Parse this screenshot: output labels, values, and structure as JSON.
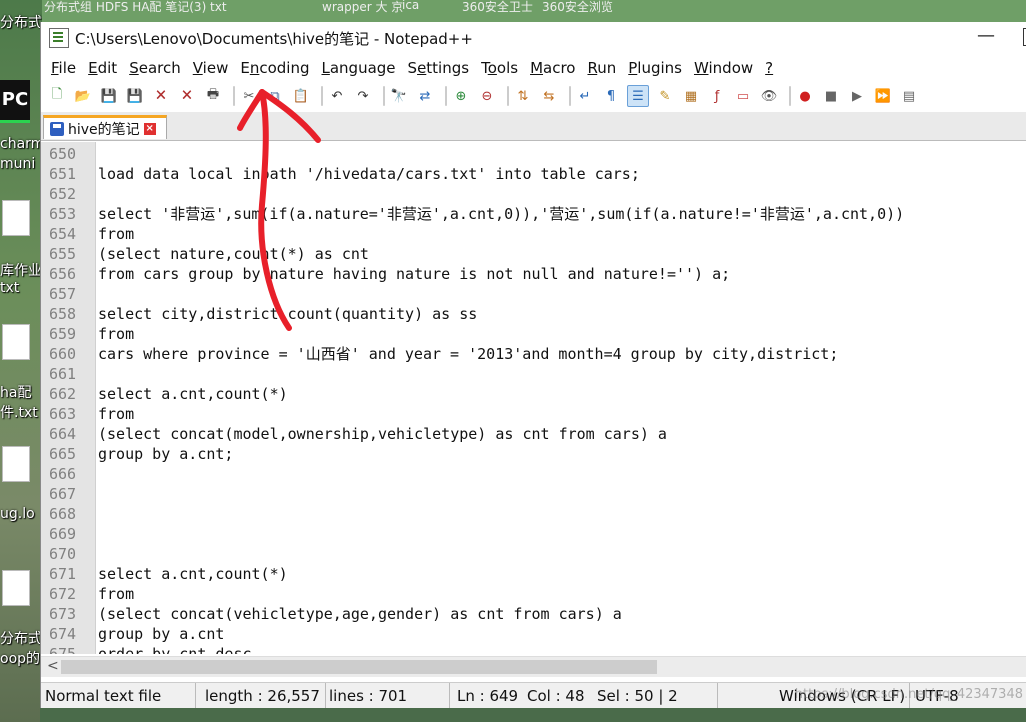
{
  "desktop": {
    "top_strip_texts": [
      "分布式组 HDFS HA配 笔记(3) txt",
      "wrapper 大 京",
      "ica",
      "360安全卫士",
      "360安全浏览"
    ],
    "icons": [
      {
        "label": "PC",
        "sub": ""
      },
      {
        "label": "charm",
        "sub": "muni"
      },
      {
        "label": "库作业",
        "sub": "txt"
      },
      {
        "label": "ha配",
        "sub": "件.txt"
      },
      {
        "label": "ug.lo",
        "sub": ""
      },
      {
        "label": "分布式",
        "sub": "oop的"
      }
    ]
  },
  "window": {
    "title": "C:\\Users\\Lenovo\\Documents\\hive的笔记 - Notepad++",
    "minimize_glyph": "—",
    "menu": [
      {
        "label": "File",
        "ul": "F",
        "rest": "ile"
      },
      {
        "label": "Edit",
        "ul": "E",
        "rest": "dit"
      },
      {
        "label": "Search",
        "ul": "S",
        "rest": "earch"
      },
      {
        "label": "View",
        "ul": "V",
        "rest": "iew"
      },
      {
        "label": "Encoding",
        "ul": "n",
        "pre": "E",
        "rest": "coding"
      },
      {
        "label": "Language",
        "ul": "L",
        "rest": "anguage"
      },
      {
        "label": "Settings",
        "ul": "e",
        "pre": "S",
        "rest": "ttings"
      },
      {
        "label": "Tools",
        "ul": "o",
        "pre": "T",
        "rest": "ols"
      },
      {
        "label": "Macro",
        "ul": "M",
        "rest": "acro"
      },
      {
        "label": "Run",
        "ul": "R",
        "rest": "un"
      },
      {
        "label": "Plugins",
        "ul": "P",
        "rest": "lugins"
      },
      {
        "label": "Window",
        "ul": "W",
        "rest": "indow"
      },
      {
        "label": "?",
        "ul": "?",
        "rest": ""
      }
    ],
    "toolbar": [
      {
        "name": "new-file-icon",
        "glyph": "🗋",
        "color": "#3a8a3a"
      },
      {
        "name": "open-file-icon",
        "glyph": "📂",
        "color": "#d8a22a"
      },
      {
        "name": "save-icon",
        "glyph": "💾",
        "color": "#3a5fa8"
      },
      {
        "name": "save-all-icon",
        "glyph": "💾",
        "color": "#3a5fa8"
      },
      {
        "name": "close-icon",
        "glyph": "🗙",
        "color": "#b03030"
      },
      {
        "name": "close-all-icon",
        "glyph": "🗙",
        "color": "#b03030"
      },
      {
        "name": "print-icon",
        "glyph": "🖶",
        "color": "#444"
      },
      {
        "name": "sep",
        "glyph": ""
      },
      {
        "name": "cut-icon",
        "glyph": "✂",
        "color": "#555"
      },
      {
        "name": "copy-icon",
        "glyph": "⧉",
        "color": "#4a6a9a"
      },
      {
        "name": "paste-icon",
        "glyph": "📋",
        "color": "#a07030"
      },
      {
        "name": "sep",
        "glyph": ""
      },
      {
        "name": "undo-icon",
        "glyph": "↶",
        "color": "#333"
      },
      {
        "name": "redo-icon",
        "glyph": "↷",
        "color": "#333"
      },
      {
        "name": "sep",
        "glyph": ""
      },
      {
        "name": "find-icon",
        "glyph": "🔭",
        "color": "#333"
      },
      {
        "name": "replace-icon",
        "glyph": "⇄",
        "color": "#2a6ab8"
      },
      {
        "name": "sep",
        "glyph": ""
      },
      {
        "name": "zoom-in-icon",
        "glyph": "⊕",
        "color": "#2a8a3a"
      },
      {
        "name": "zoom-out-icon",
        "glyph": "⊖",
        "color": "#b03030"
      },
      {
        "name": "sep",
        "glyph": ""
      },
      {
        "name": "sync-vertical-icon",
        "glyph": "⇅",
        "color": "#c07020"
      },
      {
        "name": "sync-horizontal-icon",
        "glyph": "⇆",
        "color": "#c07020"
      },
      {
        "name": "sep",
        "glyph": ""
      },
      {
        "name": "word-wrap-icon",
        "glyph": "↵",
        "color": "#2a6ab8"
      },
      {
        "name": "show-all-chars-icon",
        "glyph": "¶",
        "color": "#2a6ab8"
      },
      {
        "name": "indent-guide-icon",
        "glyph": "☰",
        "color": "#2a6ab8",
        "active": true
      },
      {
        "name": "udl-icon",
        "glyph": "✎",
        "color": "#c09020"
      },
      {
        "name": "doc-map-icon",
        "glyph": "▦",
        "color": "#b07020"
      },
      {
        "name": "function-list-icon",
        "glyph": "ƒ",
        "color": "#b03030"
      },
      {
        "name": "folder-workspace-icon",
        "glyph": "▭",
        "color": "#d05050"
      },
      {
        "name": "monitor-icon",
        "glyph": "👁",
        "color": "#555"
      },
      {
        "name": "sep",
        "glyph": ""
      },
      {
        "name": "record-macro-icon",
        "glyph": "●",
        "color": "#d02020"
      },
      {
        "name": "stop-record-icon",
        "glyph": "■",
        "color": "#666"
      },
      {
        "name": "play-macro-icon",
        "glyph": "▶",
        "color": "#666"
      },
      {
        "name": "run-macro-multiple-icon",
        "glyph": "⏩",
        "color": "#3a5fa8"
      },
      {
        "name": "save-macro-icon",
        "glyph": "▤",
        "color": "#666"
      }
    ],
    "tab": {
      "label": "hive的笔记",
      "close_glyph": "×"
    },
    "lines": [
      {
        "n": "650",
        "t": ""
      },
      {
        "n": "651",
        "t": "load data local inpath '/hivedata/cars.txt' into table cars;"
      },
      {
        "n": "652",
        "t": ""
      },
      {
        "n": "653",
        "t": "select '非营运',sum(if(a.nature='非营运',a.cnt,0)),'营运',sum(if(a.nature!='非营运',a.cnt,0))"
      },
      {
        "n": "654",
        "t": "from"
      },
      {
        "n": "655",
        "t": "(select nature,count(*) as cnt"
      },
      {
        "n": "656",
        "t": "from cars group by nature having nature is not null and nature!='') a;"
      },
      {
        "n": "657",
        "t": ""
      },
      {
        "n": "658",
        "t": "select city,district,count(quantity) as ss"
      },
      {
        "n": "659",
        "t": "from"
      },
      {
        "n": "660",
        "t": "cars where province = '山西省' and year = '2013'and month=4 group by city,district;"
      },
      {
        "n": "661",
        "t": ""
      },
      {
        "n": "662",
        "t": "select a.cnt,count(*)"
      },
      {
        "n": "663",
        "t": "from"
      },
      {
        "n": "664",
        "t": "(select concat(model,ownership,vehicletype) as cnt from cars) a"
      },
      {
        "n": "665",
        "t": "group by a.cnt;"
      },
      {
        "n": "666",
        "t": ""
      },
      {
        "n": "667",
        "t": ""
      },
      {
        "n": "668",
        "t": ""
      },
      {
        "n": "669",
        "t": ""
      },
      {
        "n": "670",
        "t": ""
      },
      {
        "n": "671",
        "t": "select a.cnt,count(*)"
      },
      {
        "n": "672",
        "t": "from"
      },
      {
        "n": "673",
        "t": "(select concat(vehicletype,age,gender) as cnt from cars) a"
      },
      {
        "n": "674",
        "t": "group by a.cnt"
      },
      {
        "n": "675",
        "t": "order by cnt desc"
      }
    ],
    "status": {
      "file_type": "Normal text file",
      "length": "length : 26,557",
      "lines": "lines : 701",
      "ln": "Ln : 649",
      "col": "Col : 48",
      "sel": "Sel : 50 | 2",
      "eol": "Windows (CR LF)",
      "encoding": "UTF-8",
      "watermark": "https://blog.csdn.net/qq_42347348"
    },
    "scroll_left_glyph": "<"
  },
  "colors": {
    "annotation": "#e8202a",
    "tab_accent": "#f5a623",
    "gutter": "#e4e4e4"
  }
}
